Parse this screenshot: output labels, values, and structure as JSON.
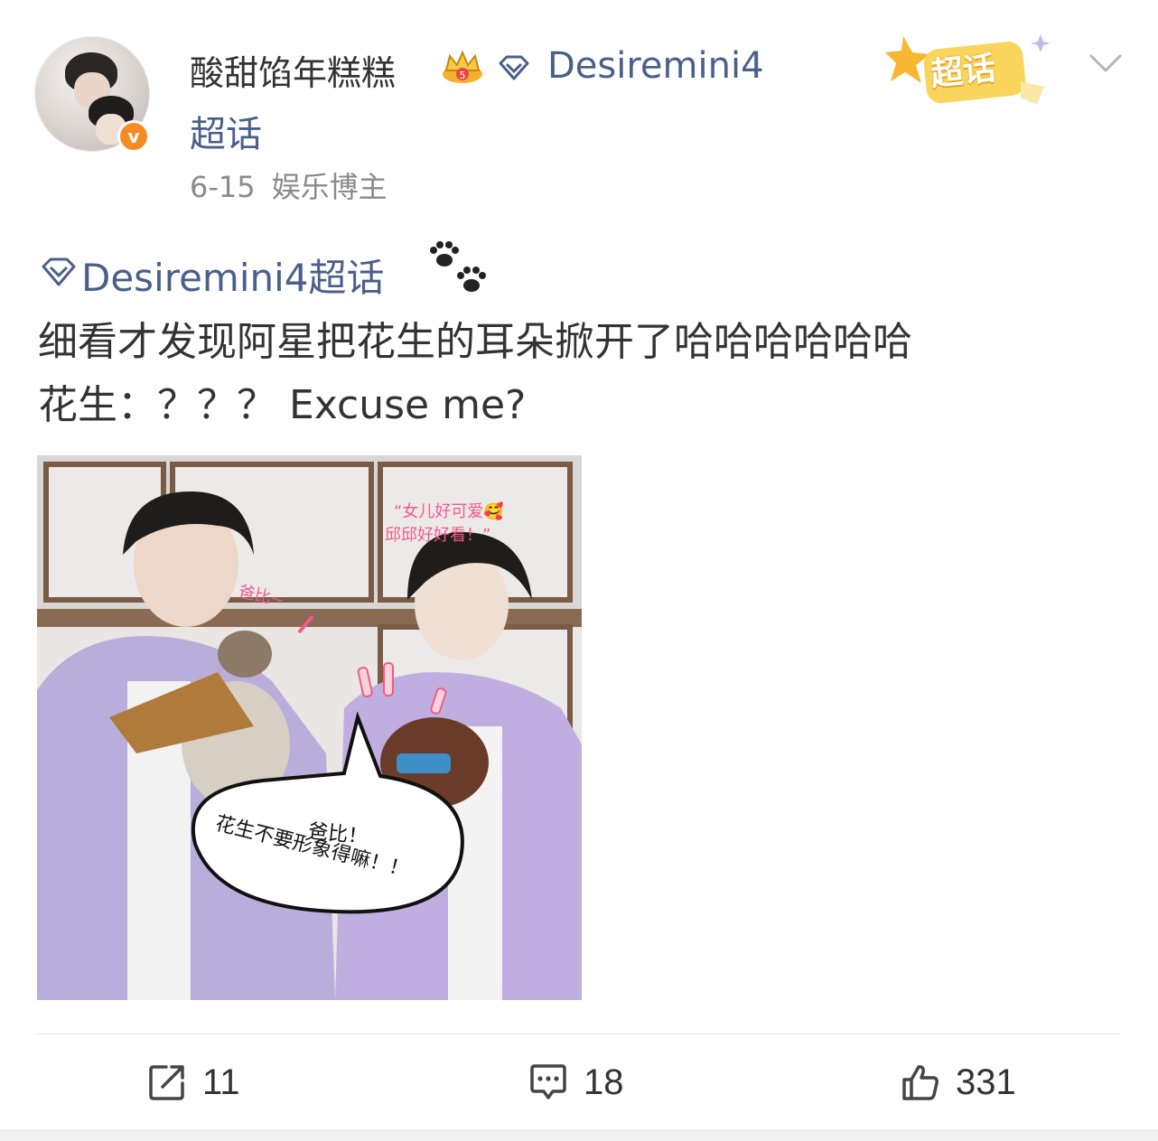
{
  "post": {
    "username": "酸甜馅年糕糕",
    "topic_header": "Desiremini4",
    "topic_header_suffix": "超话",
    "date": "6-15",
    "role": "娱乐博主",
    "chaohua_badge": "超话",
    "topic_tag": "Desiremini4超话",
    "text_line1": "细看才发现阿星把花生的耳朵掀开了哈哈哈哈哈哈",
    "text_line2": "花生：？？？ Excuse me?",
    "image_captions": {
      "top_right_line1": "“女儿好可爱🥰",
      "top_right_line2": "邱邱好好看！”",
      "left_label": "爸比~",
      "bubble_line1": "爸比！",
      "bubble_line2": "花生不要形象得嘛！！"
    }
  },
  "actions": {
    "repost_count": "11",
    "comment_count": "18",
    "like_count": "331"
  },
  "colors": {
    "link": "#4a5f8c",
    "verified": "#f58c23",
    "badge": "#f7c948",
    "shirt": "#b7a6d9"
  },
  "icons": [
    "verified-icon",
    "crown-badge-icon",
    "diamond-icon",
    "chevron-down-icon",
    "paw-icon",
    "repost-icon",
    "comment-icon",
    "like-icon"
  ]
}
